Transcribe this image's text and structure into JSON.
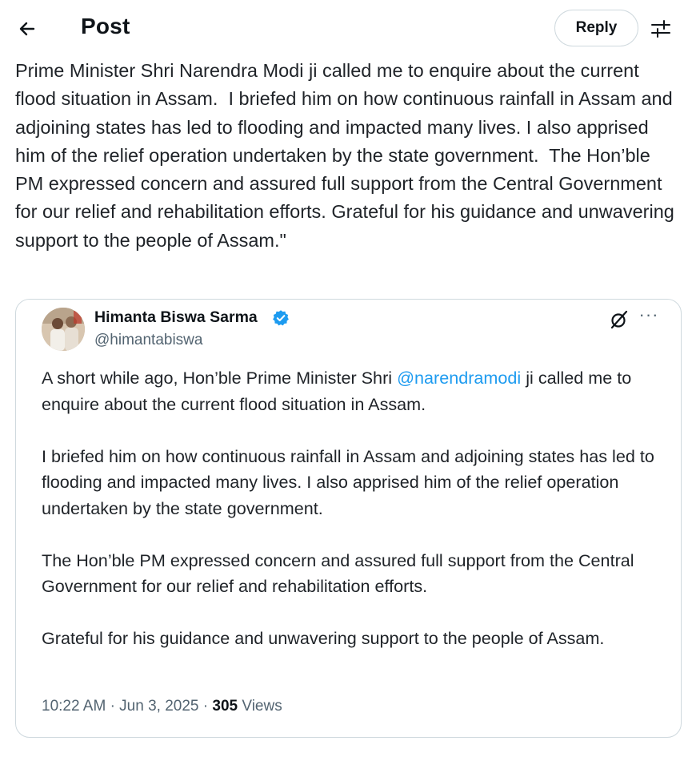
{
  "header": {
    "title": "Post",
    "reply_label": "Reply"
  },
  "post": {
    "text": "Prime Minister Shri Narendra Modi ji called me to enquire about the current flood situation in Assam.  I briefed him on how continuous rainfall in Assam and adjoining states has led to flooding and impacted many lives. I also apprised him of the relief operation undertaken by the state government.  The Hon’ble PM expressed concern and assured full support from the Central Government for our relief and rehabilitation efforts. Grateful for his guidance and unwavering support to the people of Assam.\""
  },
  "quote": {
    "author_name": "Himanta Biswa Sarma",
    "author_handle": "@himantabiswa",
    "para1_before": "A short while ago, Hon’ble Prime Minister Shri ",
    "mention": "@narendramodi",
    "para1_after": " ji called me to enquire about the current flood situation in Assam.",
    "para2": "I briefed him on how continuous rainfall in Assam and adjoining states has led to flooding and impacted many lives. I also apprised him of the relief operation undertaken by the state government.",
    "para3": "The Hon’ble PM expressed concern and assured full support from the Central Government for our relief and rehabilitation efforts.",
    "para4": "Grateful for his guidance and unwavering support to the people of Assam.",
    "time": "10:22 AM",
    "date": "Jun 3, 2025",
    "views_count": "305",
    "views_label": "Views",
    "separator": "·"
  },
  "icons": {
    "back": "arrow-left-icon",
    "filter": "sliders-icon",
    "verified": "verified-badge-icon",
    "grok": "grok-icon",
    "more": "more-icon"
  },
  "colors": {
    "link": "#1d9bf0",
    "muted": "#536471",
    "border": "#cfd9de",
    "text": "#0f1419"
  }
}
